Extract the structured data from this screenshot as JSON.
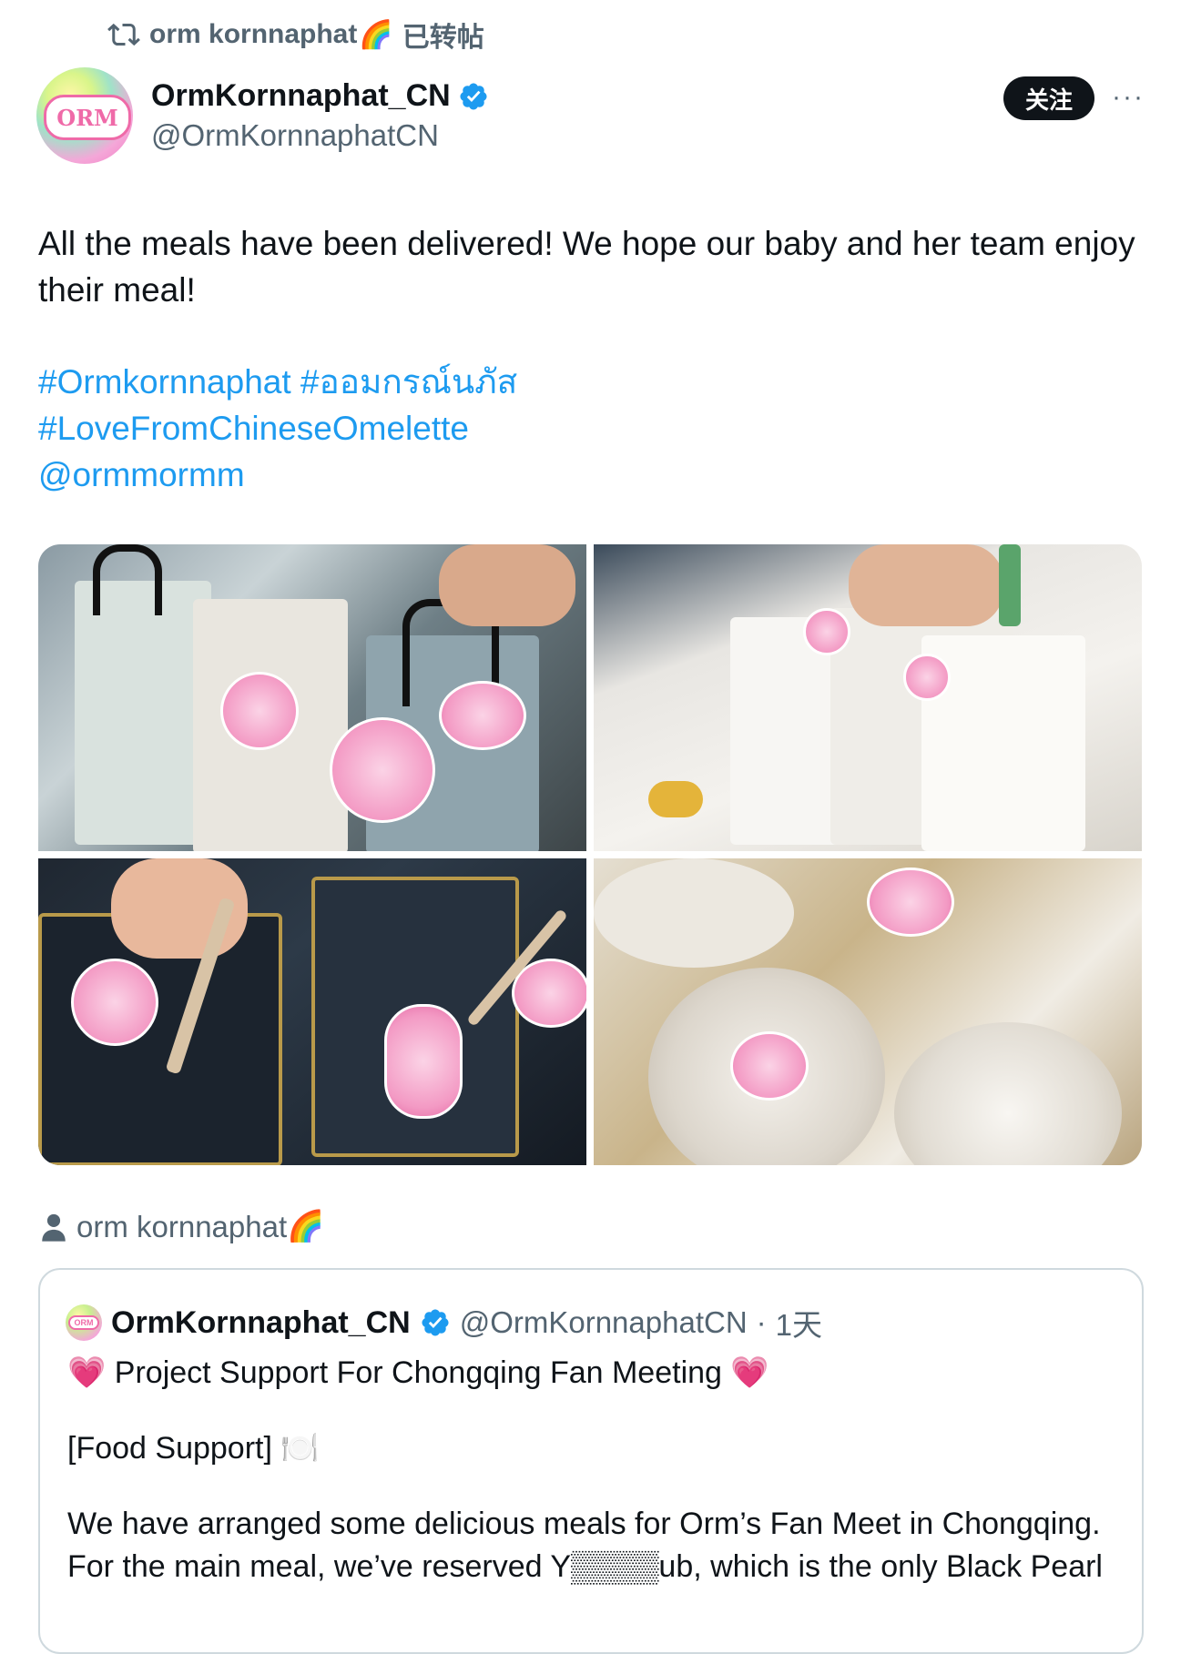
{
  "repost": {
    "icon": "repost-icon",
    "user": "orm kornnaphat",
    "emoji": "🌈",
    "label": "已转帖"
  },
  "author": {
    "avatar_text": "ORM",
    "name": "OrmKornnaphat_CN",
    "handle": "@OrmKornnaphatCN",
    "verified": true
  },
  "actions": {
    "follow_label": "关注",
    "more_label": "···"
  },
  "tweet": {
    "text": "All the meals have been delivered! We hope our baby and her team enjoy their meal!",
    "tags": [
      "#Ormkornnaphat #ออมกรณ์นภัส",
      "#LoveFromChineseOmelette",
      "@ormmormm"
    ]
  },
  "media_count": 4,
  "quote_owner": {
    "name": "orm kornnaphat",
    "emoji": "🌈"
  },
  "quote": {
    "name": "OrmKornnaphat_CN",
    "handle": "@OrmKornnaphatCN",
    "separator": "·",
    "time": "1天",
    "title": "Project Support For Chongqing Fan Meeting",
    "heart": "💗",
    "section": "[Food Support] 🍽️",
    "para1": "We have arranged some delicious meals for Orm’s Fan Meet in Chongqing.",
    "para2": "For the main meal, we’ve reserved Y▒▒▒▒ub, which is the only Black Pearl"
  },
  "colors": {
    "link": "#1d9bf0",
    "secondary_text": "#536471",
    "verified": "#1d9bf0",
    "follow_bg": "#0f1419"
  }
}
